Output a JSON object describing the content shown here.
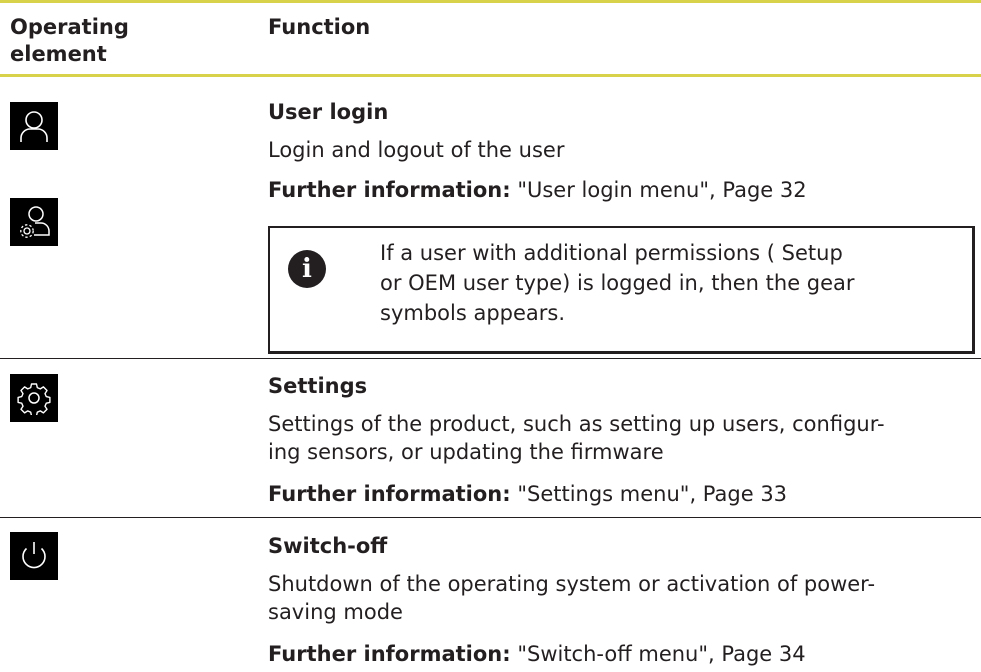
{
  "table": {
    "headers": {
      "col1": "Operating element",
      "col1_line1": "Operating",
      "col1_line2": "element",
      "col2": "Function"
    },
    "rows": [
      {
        "icon": "user-icon",
        "title": "User login",
        "description": "Login and logout of the user",
        "further_label": "Further information:",
        "further_text": "\"User login menu\", Page 32"
      },
      {
        "icon": "user-gear-icon",
        "note": "If a user with additional permissions ( Setup or OEM user type) is logged in, then the gear symbols appears.",
        "note_line1": "If a user with additional permissions ( Setup",
        "note_line2": "or OEM user type) is logged in, then the gear",
        "note_line3": "symbols appears."
      },
      {
        "icon": "gear-icon",
        "title": "Settings",
        "description_line1": "Settings of the product, such as setting up users, configur-",
        "description_line2": "ing sensors, or updating the firmware",
        "further_label": "Further information:",
        "further_text": "\"Settings menu\", Page 33"
      },
      {
        "icon": "power-icon",
        "title": "Switch-off",
        "description_line1": "Shutdown of the operating system or activation of power-",
        "description_line2": "saving mode",
        "further_label": "Further information:",
        "further_text": "\"Switch-off menu\", Page 34"
      }
    ]
  },
  "colors": {
    "header_rule": "#d7d24a",
    "text": "#231f20",
    "icon_bg": "#000000"
  }
}
